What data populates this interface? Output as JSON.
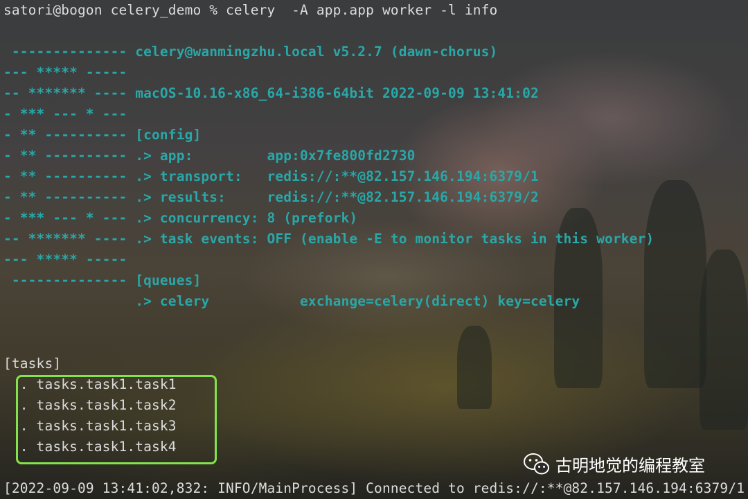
{
  "terminal": {
    "prompt": "satori@bogon celery_demo % celery  -A app.app worker -l info",
    "banner": [
      " -------------- celery@wanmingzhu.local v5.2.7 (dawn-chorus)",
      "--- ***** -----",
      "-- ******* ---- macOS-10.16-x86_64-i386-64bit 2022-09-09 13:41:02",
      "- *** --- * ---",
      "- ** ---------- [config]",
      "- ** ---------- .> app:         app:0x7fe800fd2730",
      "- ** ---------- .> transport:   redis://:**@82.157.146.194:6379/1",
      "- ** ---------- .> results:     redis://:**@82.157.146.194:6379/2",
      "- *** --- * --- .> concurrency: 8 (prefork)",
      "-- ******* ---- .> task events: OFF (enable -E to monitor tasks in this worker)",
      "--- ***** -----",
      " -------------- [queues]",
      "                .> celery           exchange=celery(direct) key=celery"
    ],
    "tasks_header": "[tasks]",
    "tasks": [
      "  . tasks.task1.task1",
      "  . tasks.task1.task2",
      "  . tasks.task1.task3",
      "  . tasks.task1.task4"
    ],
    "log_line": "[2022-09-09 13:41:02,832: INFO/MainProcess] Connected to redis://:**@82.157.146.194:6379/1"
  },
  "watermark": {
    "text": "古明地觉的编程教室",
    "icon": "wechat-icon"
  },
  "colors": {
    "banner_text": "#2aa7a8",
    "plain_text": "#dcdcdc",
    "highlight_box": "#84e34d"
  }
}
